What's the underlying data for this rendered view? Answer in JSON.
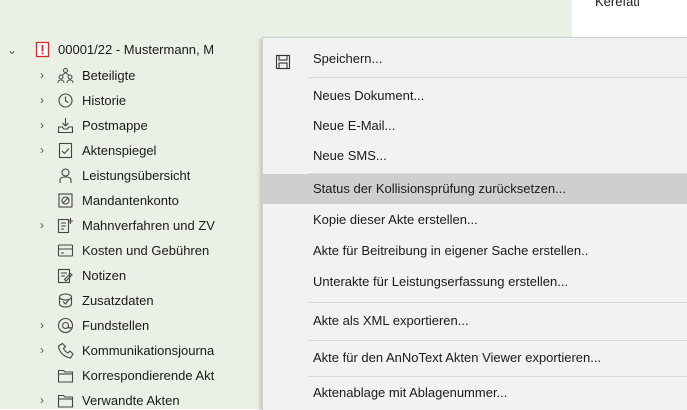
{
  "right_header": "Kerefati",
  "tree": {
    "root": {
      "label": "00001/22 - Mustermann, M"
    },
    "children": [
      {
        "label": "Beteiligte",
        "expandable": true,
        "icon": "people-icon"
      },
      {
        "label": "Historie",
        "expandable": true,
        "icon": "history-icon"
      },
      {
        "label": "Postmappe",
        "expandable": true,
        "icon": "inbox-icon"
      },
      {
        "label": "Aktenspiegel",
        "expandable": true,
        "icon": "checklist-icon"
      },
      {
        "label": "Leistungsübersicht",
        "expandable": false,
        "icon": "services-icon"
      },
      {
        "label": "Mandantenkonto",
        "expandable": false,
        "icon": "account-icon"
      },
      {
        "label": "Mahnverfahren und ZV",
        "expandable": true,
        "icon": "dunning-icon"
      },
      {
        "label": "Kosten und Gebühren",
        "expandable": false,
        "icon": "costs-icon"
      },
      {
        "label": "Notizen",
        "expandable": false,
        "icon": "notes-icon"
      },
      {
        "label": "Zusatzdaten",
        "expandable": false,
        "icon": "extra-data-icon"
      },
      {
        "label": "Fundstellen",
        "expandable": true,
        "icon": "at-icon"
      },
      {
        "label": "Kommunikationsjourna",
        "expandable": true,
        "icon": "communication-icon"
      },
      {
        "label": "Korrespondierende Akt",
        "expandable": false,
        "icon": "folder-icon"
      },
      {
        "label": "Verwandte Akten",
        "expandable": true,
        "icon": "folder-icon"
      }
    ]
  },
  "context_menu": {
    "items": [
      {
        "label": "Speichern...",
        "icon": "save-icon"
      },
      {
        "label": "Neues Dokument..."
      },
      {
        "label": "Neue E-Mail..."
      },
      {
        "label": "Neue SMS..."
      },
      {
        "label": "Status der Kollisionsprüfung zurücksetzen...",
        "highlighted": true
      },
      {
        "label": "Kopie dieser Akte erstellen..."
      },
      {
        "label": "Akte für Beitreibung in eigener Sache erstellen.."
      },
      {
        "label": "Unterakte für Leistungserfassung erstellen..."
      },
      {
        "label": "Akte als XML exportieren..."
      },
      {
        "label": "Akte für den AnNoText Akten Viewer exportieren..."
      },
      {
        "label": "Aktenablage mit Ablagenummer..."
      }
    ]
  },
  "colors": {
    "alert_red": "#d52b2b",
    "menu_highlight": "#cfcfcf",
    "tree_bg": "#eaf0e6"
  }
}
